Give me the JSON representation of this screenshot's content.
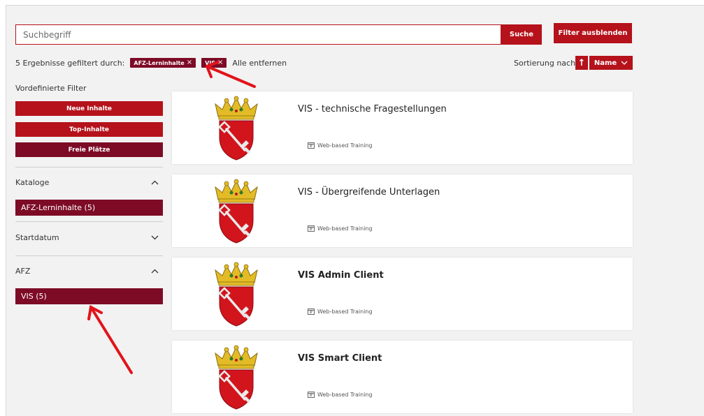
{
  "search": {
    "placeholder": "Suchbegriff",
    "button_label": "Suche"
  },
  "filter_toggle_label": "Filter ausblenden",
  "filter_status": {
    "count_text": "5 Ergebnisse gefiltert durch:",
    "chips": [
      "AFZ-Lerninhalte",
      "VIS"
    ],
    "chip_remove_glyph": "×",
    "remove_all_label": "Alle entfernen"
  },
  "sort": {
    "label": "Sortierung nach:",
    "direction_icon": "arrow-up-icon",
    "direction_glyph": "↑",
    "field_value": "Name",
    "field_icon": "chevron-down-icon"
  },
  "sidebar": {
    "predefined_heading": "Vordefinierte Filter",
    "predefined_buttons": [
      "Neue Inhalte",
      "Top-Inhalte",
      "Freie Plätze"
    ],
    "facets": [
      {
        "label": "Kataloge",
        "expanded": true,
        "icon": "chevron-up-icon",
        "items": [
          "AFZ-Lerninhalte (5)"
        ]
      },
      {
        "label": "Startdatum",
        "expanded": false,
        "icon": "chevron-down-icon",
        "items": []
      },
      {
        "label": "AFZ",
        "expanded": true,
        "icon": "chevron-up-icon",
        "items": [
          "VIS (5)"
        ]
      }
    ]
  },
  "results": [
    {
      "title": "VIS - technische Fragestellungen",
      "type": "Web-based Training",
      "image_icon": "bremen-coat-of-arms-icon",
      "type_icon": "web-training-icon"
    },
    {
      "title": "VIS - Übergreifende Unterlagen",
      "type": "Web-based Training",
      "image_icon": "bremen-coat-of-arms-icon",
      "type_icon": "web-training-icon"
    },
    {
      "title": "VIS Admin Client",
      "type": "Web-based Training",
      "image_icon": "bremen-coat-of-arms-icon",
      "type_icon": "web-training-icon"
    },
    {
      "title": "VIS Smart Client",
      "type": "Web-based Training",
      "image_icon": "bremen-coat-of-arms-icon",
      "type_icon": "web-training-icon"
    }
  ],
  "colors": {
    "primary_red": "#b5121b",
    "dark_red": "#7d0b26",
    "annotation_arrow": "#e1141b",
    "page_background": "#f2f2f2"
  }
}
